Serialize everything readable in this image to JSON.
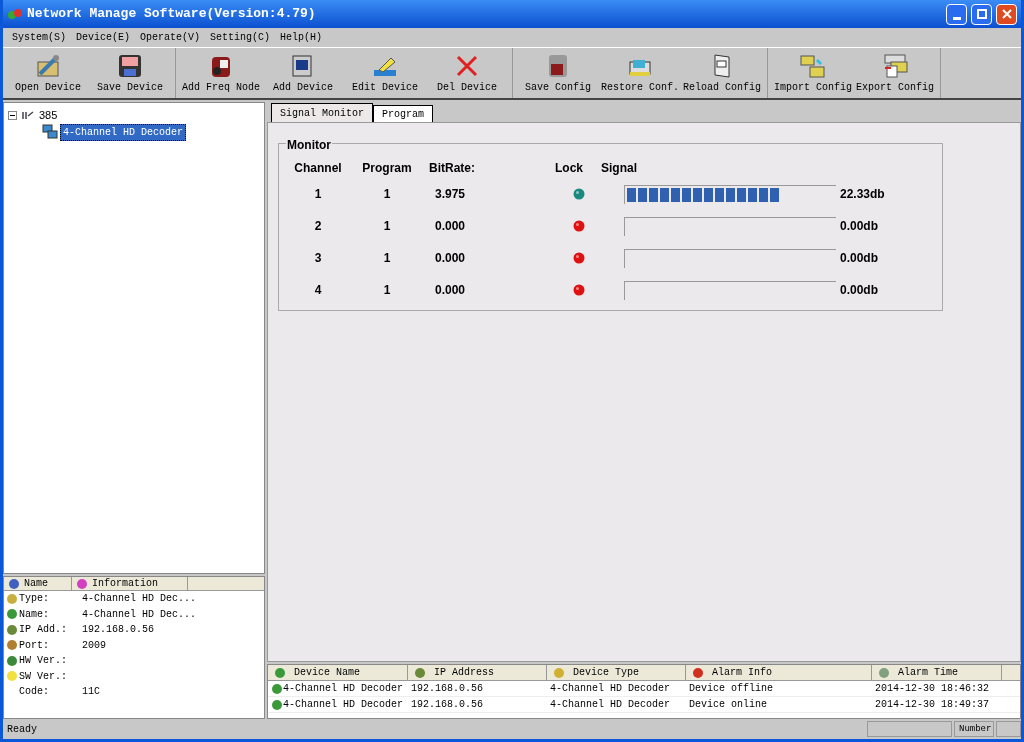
{
  "window": {
    "title": "Network Manage Software(Version:4.79)"
  },
  "menu": [
    "System(S)",
    "Device(E)",
    "Operate(V)",
    "Setting(C)",
    "Help(H)"
  ],
  "toolbar": {
    "groups": [
      [
        "Open Device",
        "Save Device"
      ],
      [
        "Add Freq Node",
        "Add Device",
        "Edit Device",
        "Del Device"
      ],
      [
        "Save Config",
        "Restore Conf.",
        "Reload Config"
      ],
      [
        "Import Config",
        "Export Config"
      ]
    ]
  },
  "tree": {
    "label": "385",
    "expanded": true,
    "children": [
      {
        "label": "4-Channel HD Decoder",
        "selected": true
      }
    ]
  },
  "info": {
    "columns": [
      "Name",
      "Information"
    ],
    "rows": [
      {
        "name": "Type:",
        "value": "4-Channel HD Dec..."
      },
      {
        "name": "Name:",
        "value": "4-Channel HD Dec..."
      },
      {
        "name": "IP Add.:",
        "value": "192.168.0.56"
      },
      {
        "name": "Port:",
        "value": "2009"
      },
      {
        "name": "HW Ver.:"
      },
      {
        "name": "SW Ver.:"
      },
      {
        "name": "Code:",
        "value": "11C"
      }
    ]
  },
  "tabs": [
    {
      "label": "Signal Monitor",
      "selected": true
    },
    {
      "label": "Program",
      "selected": false
    }
  ],
  "monitor": {
    "title": "Monitor",
    "columns": [
      "Channel",
      "Program",
      "BitRate:",
      "Lock",
      "Signal"
    ],
    "rows": [
      {
        "channel": "1",
        "program": "1",
        "bitrate": "3.975",
        "locked": true,
        "level": 0.74,
        "reading": "22.33db"
      },
      {
        "channel": "2",
        "program": "1",
        "bitrate": "0.000",
        "locked": false,
        "level": 0,
        "reading": "0.00db"
      },
      {
        "channel": "3",
        "program": "1",
        "bitrate": "0.000",
        "locked": false,
        "level": 0,
        "reading": "0.00db"
      },
      {
        "channel": "4",
        "program": "1",
        "bitrate": "0.000",
        "locked": false,
        "level": 0,
        "reading": "0.00db"
      }
    ]
  },
  "alarms": {
    "columns": [
      "Device Name",
      "IP Address",
      "Device Type",
      "Alarm Info",
      "Alarm Time"
    ],
    "rows": [
      [
        "4-Channel HD Decoder",
        "192.168.0.56",
        "4-Channel HD Decoder",
        "Device offline",
        "2014-12-30 18:46:32"
      ],
      [
        "4-Channel HD Decoder",
        "192.168.0.56",
        "4-Channel HD Decoder",
        "Device online",
        "2014-12-30 18:49:37"
      ]
    ]
  },
  "status_bar": {
    "message": "Ready",
    "number_label": "Number"
  }
}
